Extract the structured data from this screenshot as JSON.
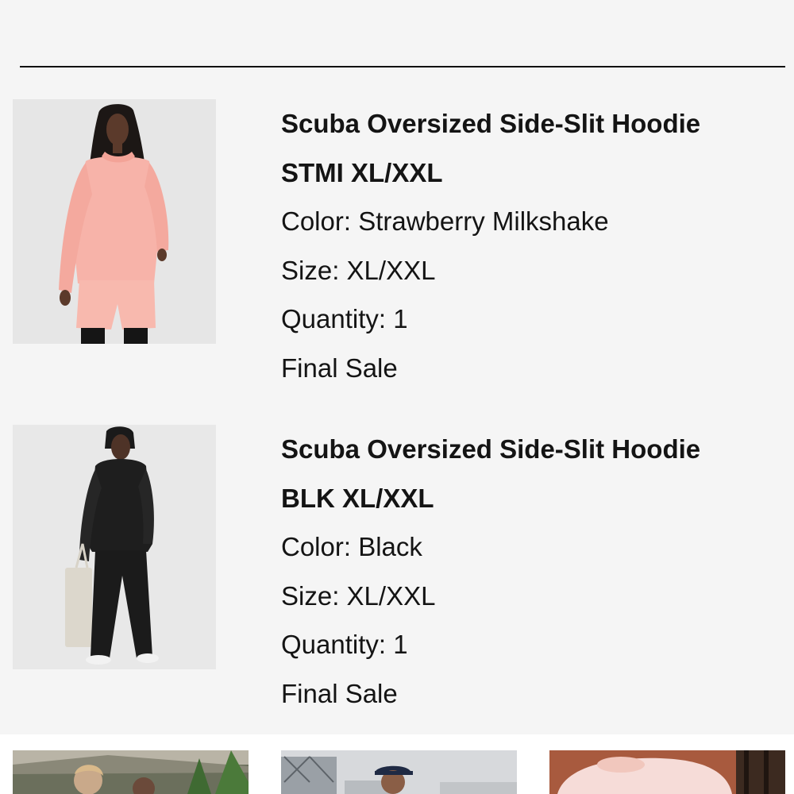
{
  "order_items": [
    {
      "name": "Scuba Oversized Side-Slit Hoodie",
      "sku": "STMI XL/XXL",
      "color": "Color: Strawberry Milkshake",
      "size": "Size: XL/XXL",
      "quantity": "Quantity: 1",
      "sale_note": "Final Sale"
    },
    {
      "name": "Scuba Oversized Side-Slit Hoodie",
      "sku": "BLK XL/XXL",
      "color": "Color: Black",
      "size": "Size: XL/XXL",
      "quantity": "Quantity: 1",
      "sale_note": "Final Sale"
    }
  ],
  "colors": {
    "background": "#f5f5f5",
    "divider": "#111111",
    "text": "#141414",
    "hoodie_pink": "#f7b3a9",
    "hoodie_black": "#1e1e1e"
  }
}
